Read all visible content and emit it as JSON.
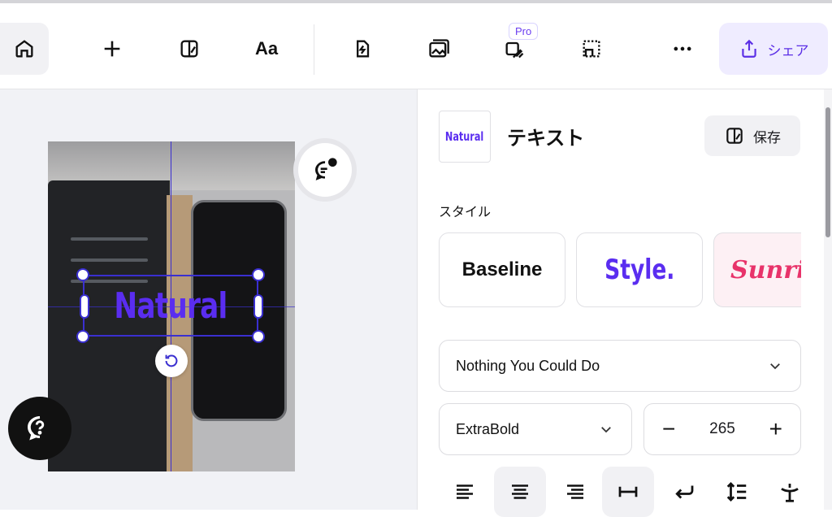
{
  "toolbar": {
    "items": [
      {
        "name": "home-icon"
      },
      {
        "name": "add-icon"
      },
      {
        "name": "brand-kit-icon"
      },
      {
        "label": "Aa"
      },
      {
        "name": "magic-icon"
      },
      {
        "name": "image-icon"
      },
      {
        "name": "background-remove-icon",
        "badge": "Pro"
      },
      {
        "name": "crop-icon"
      },
      {
        "name": "more-icon"
      }
    ],
    "share_label": "シェア"
  },
  "canvas": {
    "text_layer": "Natural"
  },
  "panel": {
    "thumbnail_text": "Natural",
    "title": "テキスト",
    "save_label": "保存",
    "style_section": "スタイル",
    "styles": [
      "Baseline",
      "Style.",
      "Sunrise"
    ],
    "font_family": "Nothing You Could Do",
    "font_weight": "ExtraBold",
    "font_size": "265",
    "stepper_minus": "−",
    "stepper_plus": "+"
  },
  "colors": {
    "accent": "#5a2df0",
    "selection": "#3a2fd0",
    "share_bg": "#efecff"
  }
}
